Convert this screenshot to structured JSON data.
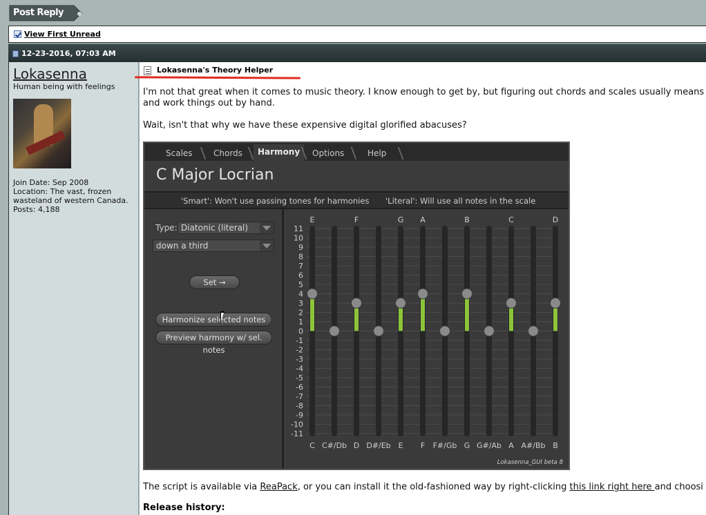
{
  "post_reply": {
    "label": "Post Reply"
  },
  "view_first_unread": {
    "label": "View First Unread"
  },
  "post_header": {
    "date": "12-23-2016, 07:03 AM"
  },
  "user": {
    "name": "Lokasenna",
    "title": "Human being with feelings",
    "join_date": "Join Date: Sep 2008",
    "location": "Location: The vast, frozen wasteland of western Canada.",
    "posts": "Posts: 4,188"
  },
  "post": {
    "title": "Lokasenna's Theory Helper",
    "para1_line1": "I'm not that great when it comes to music theory. I know enough to get by, but figuring out chords and scales usually means",
    "para1_line2": "and work things out by hand.",
    "para2": "Wait, isn't that why we have these expensive digital glorified abacuses?",
    "para3_a": "The script is available via ",
    "para3_link1": "ReaPack",
    "para3_b": ", or you can install it the old-fashioned way by right-clicking ",
    "para3_link2": "this link right here ",
    "para3_c": "and choosi",
    "release_history": "Release history:"
  },
  "gui": {
    "tabs": [
      "Scales",
      "Chords",
      "Harmony",
      "Options",
      "Help"
    ],
    "active_tab": "Harmony",
    "heading": "C Major Locrian",
    "info_smart": "'Smart': Won't use passing tones for harmonies",
    "info_literal": "'Literal': Will use all notes in the scale",
    "type_label": "Type:",
    "type_value": "Diatonic (literal)",
    "interval_value": "down a third",
    "set_button": "Set →",
    "harmonize_button": "Harmonize selected notes",
    "preview_button": "Preview harmony w/ sel. notes",
    "watermark": "Lokasenna_GUI beta 8",
    "accent_color": "#8cc43a",
    "y_ticks": [
      "11",
      "10",
      "9",
      "8",
      "7",
      "6",
      "5",
      "4",
      "3",
      "2",
      "1",
      "0",
      "-1",
      "-2",
      "-3",
      "-4",
      "-5",
      "-6",
      "-7",
      "-8",
      "-9",
      "-10",
      "-11"
    ],
    "sliders": [
      {
        "note": "C",
        "top_label": "E",
        "value": 4,
        "active": true
      },
      {
        "note": "C#/Db",
        "top_label": "",
        "value": 0,
        "active": false
      },
      {
        "note": "D",
        "top_label": "F",
        "value": 3,
        "active": true
      },
      {
        "note": "D#/Eb",
        "top_label": "",
        "value": 0,
        "active": false
      },
      {
        "note": "E",
        "top_label": "G",
        "value": 3,
        "active": true
      },
      {
        "note": "F",
        "top_label": "A",
        "value": 4,
        "active": true
      },
      {
        "note": "F#/Gb",
        "top_label": "",
        "value": 0,
        "active": false
      },
      {
        "note": "G",
        "top_label": "B",
        "value": 4,
        "active": true
      },
      {
        "note": "G#/Ab",
        "top_label": "",
        "value": 0,
        "active": false
      },
      {
        "note": "A",
        "top_label": "C",
        "value": 3,
        "active": true
      },
      {
        "note": "A#/Bb",
        "top_label": "",
        "value": 0,
        "active": false
      },
      {
        "note": "B",
        "top_label": "D",
        "value": 3,
        "active": true
      }
    ]
  }
}
